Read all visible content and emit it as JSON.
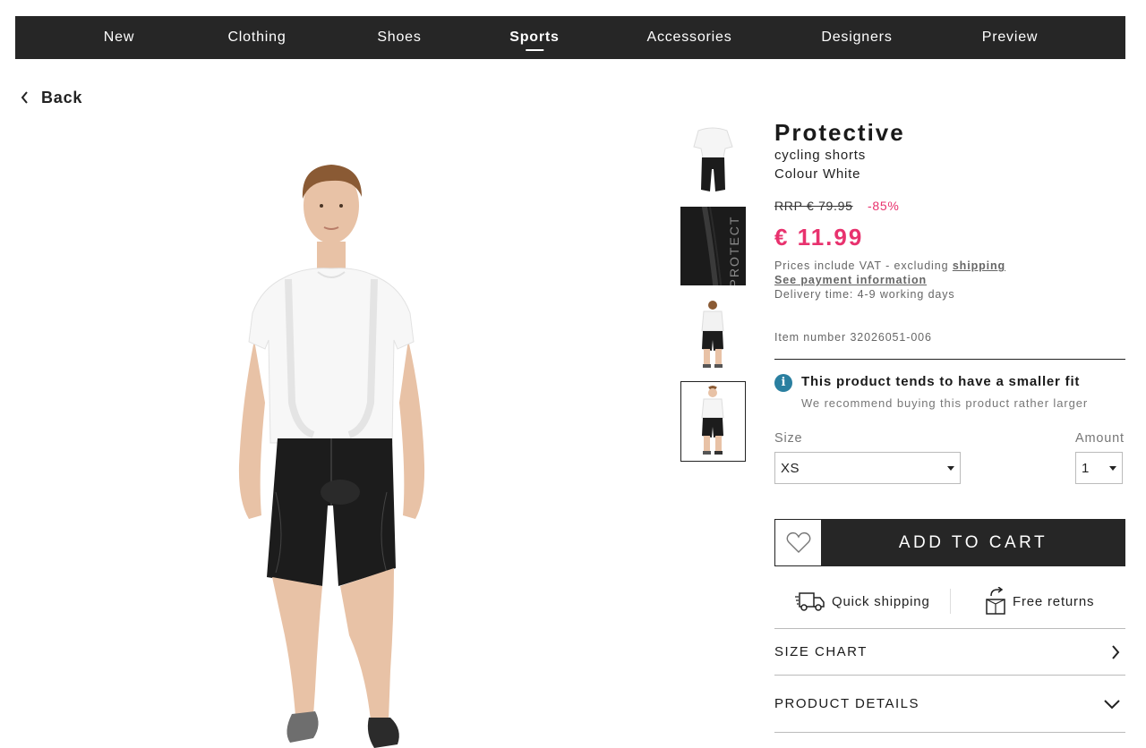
{
  "nav": {
    "items": [
      {
        "label": "New"
      },
      {
        "label": "Clothing"
      },
      {
        "label": "Shoes"
      },
      {
        "label": "Sports"
      },
      {
        "label": "Accessories"
      },
      {
        "label": "Designers"
      },
      {
        "label": "Preview"
      }
    ],
    "active": "Sports"
  },
  "back": {
    "label": "Back",
    "icon": "chevron-left-icon"
  },
  "product": {
    "brand": "Protective",
    "name": "cycling shorts",
    "colour": "Colour White",
    "rrp": "RRP € 79.95",
    "discount": "-85%",
    "price": "€ 11.99",
    "vat_text": "Prices include VAT - excluding ",
    "shipping_link": "shipping",
    "payment_link": "See payment information",
    "delivery": "Delivery time: 4-9 working days",
    "item_number": "Item number 32026051-006",
    "price_color": "#e8326e"
  },
  "fit": {
    "icon": "info-icon",
    "title": "This product tends to have a smaller fit",
    "subtitle": "We recommend buying this product rather larger"
  },
  "size": {
    "label": "Size",
    "value": "XS"
  },
  "amount": {
    "label": "Amount",
    "value": "1"
  },
  "cart": {
    "label": "ADD TO CART",
    "wishlist_icon": "heart-icon"
  },
  "usps": [
    {
      "icon": "delivery-truck-icon",
      "label": "Quick shipping"
    },
    {
      "icon": "return-box-icon",
      "label": "Free returns"
    }
  ],
  "accordions": [
    {
      "title": "SIZE CHART",
      "icon": "chevron-right-icon"
    },
    {
      "title": "PRODUCT DETAILS",
      "icon": "chevron-down-icon"
    }
  ],
  "thumbnails": [
    {
      "name": "thumbnail-front-top"
    },
    {
      "name": "thumbnail-fabric-detail"
    },
    {
      "name": "thumbnail-back"
    },
    {
      "name": "thumbnail-front-full"
    }
  ],
  "images": {
    "thumb_texture_text": "PROTECT"
  }
}
